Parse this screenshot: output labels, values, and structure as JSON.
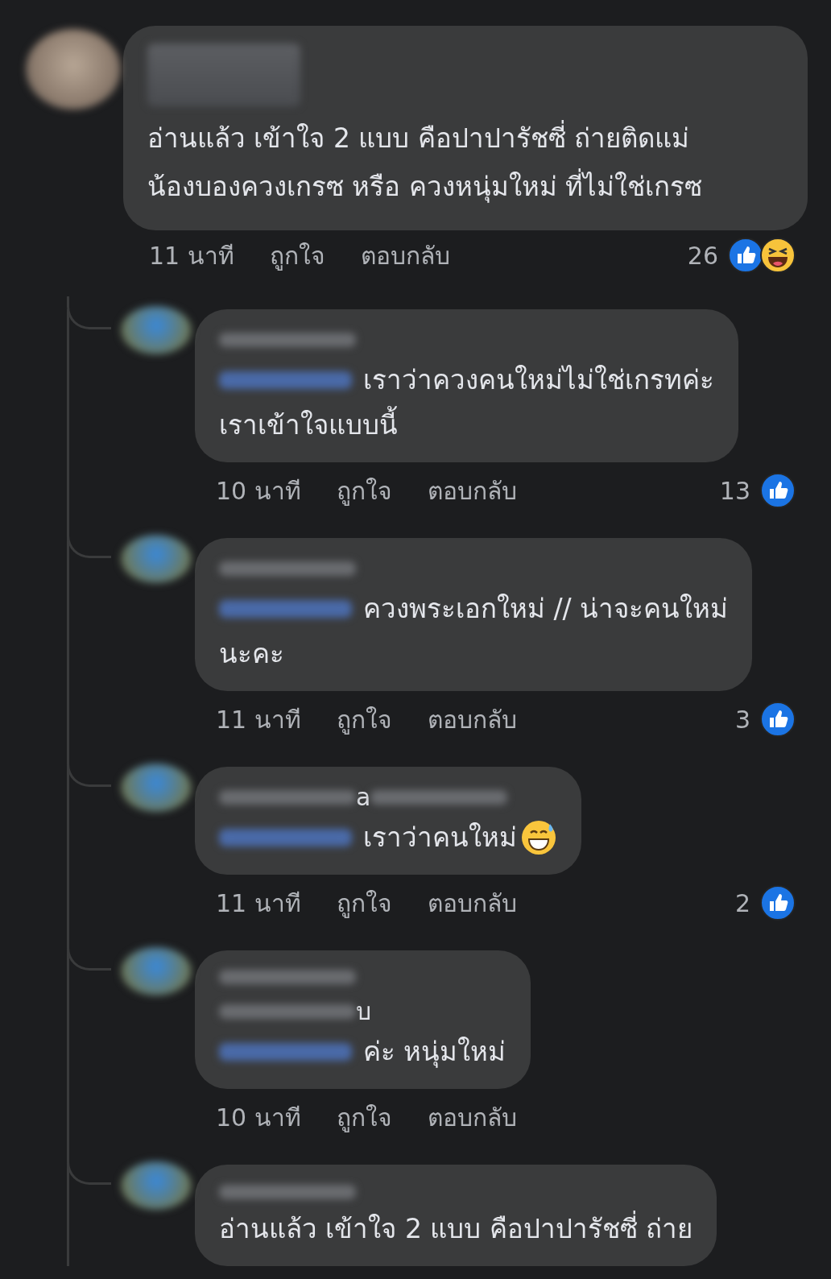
{
  "comment": {
    "lines": [
      "อ่านแล้ว เข้าใจ 2 แบบ  คือปาปารัชซี่ ถ่ายติดแม่",
      "น้องบองควงเกรซ หรือ ควงหนุ่มใหม่ ที่ไม่ใช่เกรซ"
    ],
    "time": "11 นาที",
    "like_label": "ถูกใจ",
    "reply_label": "ตอบกลับ",
    "reaction_count": "26",
    "reactions": [
      {
        "kind": "like"
      },
      {
        "kind": "haha"
      }
    ]
  },
  "replies": [
    {
      "mention": true,
      "lines": [
        "เราว่าควงคนใหม่ไม่ใช่เกรทค่ะ",
        "เราเข้าใจแบบนี้"
      ],
      "time": "10 นาที",
      "like_label": "ถูกใจ",
      "reply_label": "ตอบกลับ",
      "reaction_count": "13",
      "reactions": [
        {
          "kind": "like"
        }
      ]
    },
    {
      "mention": true,
      "lines": [
        "ควงพระเอกใหม่ // น่าจะคนใหม่",
        "นะคะ"
      ],
      "time": "11 นาที",
      "like_label": "ถูกใจ",
      "reply_label": "ตอบกลับ",
      "reaction_count": "3",
      "reactions": [
        {
          "kind": "like"
        }
      ]
    },
    {
      "mention": true,
      "name_tail": "a",
      "kind": "tail-inline",
      "lines": [
        "เราว่าคนใหม่"
      ],
      "trailing": [
        {
          "kind": "grin-sweat"
        }
      ],
      "time": "11 นาที",
      "like_label": "ถูกใจ",
      "reply_label": "ตอบกลับ",
      "reaction_count": "2",
      "reactions": [
        {
          "kind": "like"
        }
      ]
    },
    {
      "mention": true,
      "name_tail": "บ",
      "kind": "tail-wrapped",
      "lines": [
        "ค่ะ หนุ่มใหม่"
      ],
      "time": "10 นาที",
      "like_label": "ถูกใจ",
      "reply_label": "ตอบกลับ"
    },
    {
      "mention": false,
      "lines": [
        "อ่านแล้ว เข้าใจ 2 แบบ คือปาปารัชซี่ ถ่าย"
      ]
    }
  ]
}
